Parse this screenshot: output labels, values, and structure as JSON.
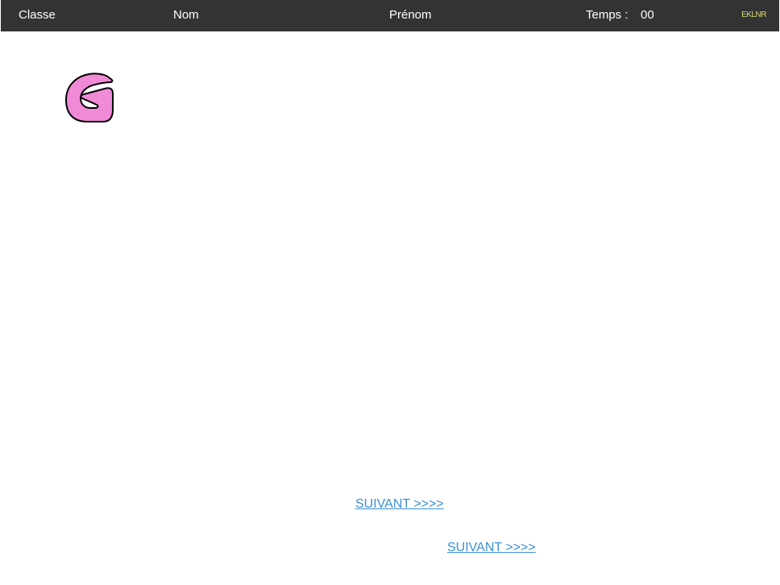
{
  "header": {
    "classe_label": "Classe",
    "nom_label": "Nom",
    "prenom_label": "Prénom",
    "temps_label": "Temps :",
    "timer_value": "00",
    "code": "EKLNR"
  },
  "stimulus": {
    "letter": "G",
    "fill_color": "#f08ad6",
    "stroke_color": "#000000"
  },
  "navigation": {
    "next_primary_label": "SUIVANT >>>>",
    "next_secondary_label": "SUIVANT >>>>"
  },
  "colors": {
    "topbar": "#333333",
    "link": "#3b8fd6",
    "code": "#dddd77"
  }
}
